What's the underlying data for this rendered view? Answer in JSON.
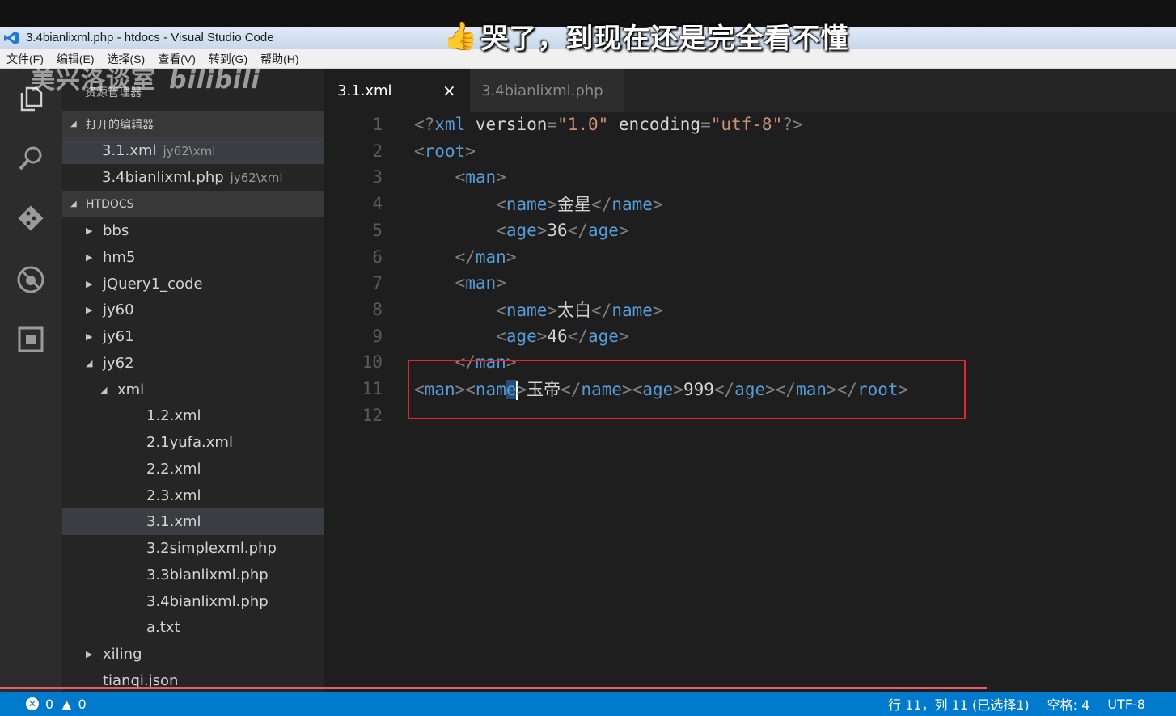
{
  "window": {
    "title": "3.4bianlixml.php - htdocs - Visual Studio Code"
  },
  "menu": [
    "文件(F)",
    "编辑(E)",
    "选择(S)",
    "查看(V)",
    "转到(G)",
    "帮助(H)"
  ],
  "overlay": {
    "caption": "哭了，到现在还是完全看不懂",
    "watermark": "美兴洛谈室",
    "watermark_logo": "bilibili"
  },
  "activity_icons": [
    "files-icon",
    "search-icon",
    "git-icon",
    "debug-icon",
    "extensions-icon"
  ],
  "sidebar": {
    "title": "资源管理器",
    "open_editors": {
      "label": "打开的编辑器",
      "items": [
        {
          "name": "3.1.xml",
          "path": "jy62\\xml"
        },
        {
          "name": "3.4bianlixml.php",
          "path": "jy62\\xml"
        }
      ]
    },
    "folder": {
      "label": "HTDOCS",
      "items": [
        {
          "name": "bbs",
          "type": "folder",
          "expanded": false,
          "depth": 0
        },
        {
          "name": "hm5",
          "type": "folder",
          "expanded": false,
          "depth": 0
        },
        {
          "name": "jQuery1_code",
          "type": "folder",
          "expanded": false,
          "depth": 0
        },
        {
          "name": "jy60",
          "type": "folder",
          "expanded": false,
          "depth": 0
        },
        {
          "name": "jy61",
          "type": "folder",
          "expanded": false,
          "depth": 0
        },
        {
          "name": "jy62",
          "type": "folder",
          "expanded": true,
          "depth": 0
        },
        {
          "name": "xml",
          "type": "folder",
          "expanded": true,
          "depth": 1
        },
        {
          "name": "1.2.xml",
          "type": "file",
          "depth": 2
        },
        {
          "name": "2.1yufa.xml",
          "type": "file",
          "depth": 2
        },
        {
          "name": "2.2.xml",
          "type": "file",
          "depth": 2
        },
        {
          "name": "2.3.xml",
          "type": "file",
          "depth": 2
        },
        {
          "name": "3.1.xml",
          "type": "file",
          "depth": 2,
          "active": true
        },
        {
          "name": "3.2simplexml.php",
          "type": "file",
          "depth": 2
        },
        {
          "name": "3.3bianlixml.php",
          "type": "file",
          "depth": 2
        },
        {
          "name": "3.4bianlixml.php",
          "type": "file",
          "depth": 2
        },
        {
          "name": "a.txt",
          "type": "file",
          "depth": 2
        },
        {
          "name": "xiling",
          "type": "folder",
          "expanded": false,
          "depth": 0
        },
        {
          "name": "tianqi.json",
          "type": "file",
          "depth": 0
        }
      ]
    }
  },
  "tabs": [
    {
      "label": "3.1.xml",
      "active": true,
      "close": "×"
    },
    {
      "label": "3.4bianlixml.php",
      "active": false
    }
  ],
  "editor": {
    "lines": [
      {
        "n": "1",
        "text": "<?xml version=\"1.0\" encoding=\"utf-8\"?>"
      },
      {
        "n": "2",
        "text": "<root>"
      },
      {
        "n": "3",
        "text": "    <man>"
      },
      {
        "n": "4",
        "text": "        <name>金星</name>"
      },
      {
        "n": "5",
        "text": "        <age>36</age>"
      },
      {
        "n": "6",
        "text": "    </man>"
      },
      {
        "n": "7",
        "text": "    <man>"
      },
      {
        "n": "8",
        "text": "        <name>太白</name>"
      },
      {
        "n": "9",
        "text": "        <age>46</age>"
      },
      {
        "n": "10",
        "text": "    </man>"
      },
      {
        "n": "11",
        "text": "<man><name>玉帝</name><age>999</age></man></root>"
      },
      {
        "n": "12",
        "text": ""
      }
    ]
  },
  "status": {
    "errors": "0",
    "warnings": "0",
    "position": "行 11，列 11 (已选择1)",
    "spaces": "空格: 4",
    "encoding": "UTF-8",
    "colors": {
      "bar": "#007acc",
      "progress": "#e85a6e",
      "highlight_box": "#e8222c"
    }
  }
}
